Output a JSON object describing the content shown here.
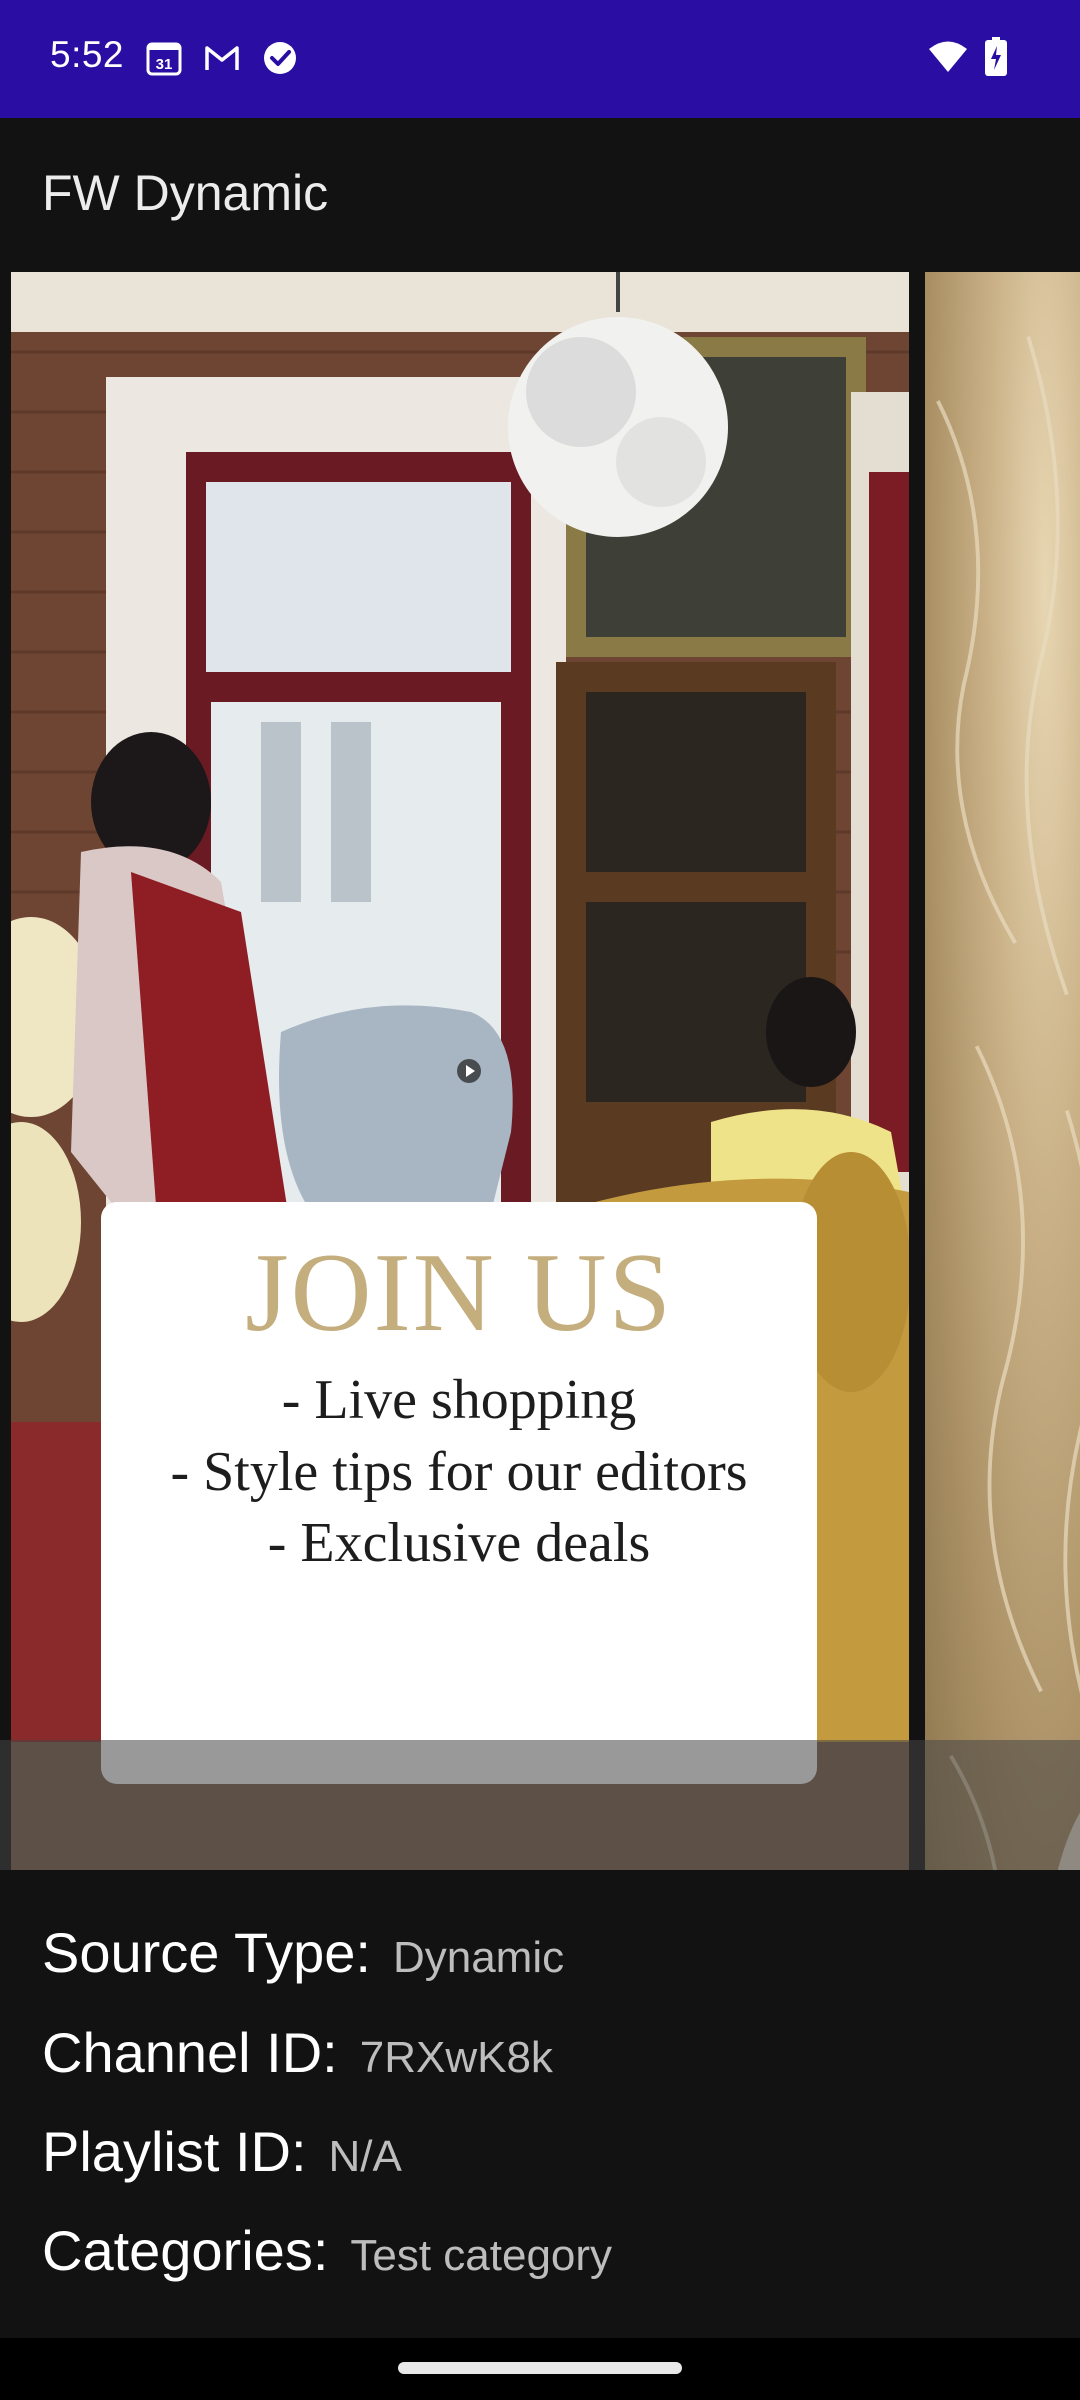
{
  "status_bar": {
    "time": "5:52",
    "icons": [
      "calendar-icon",
      "gmail-icon",
      "check-circle-icon",
      "wifi-icon",
      "battery-charging-icon"
    ],
    "background_color": "#2a0ea3"
  },
  "app_bar": {
    "title": "FW Dynamic"
  },
  "carousel": {
    "cards": [
      {
        "promo": {
          "title": "JOIN US",
          "lines": [
            "- Live shopping",
            "- Style tips for our editors",
            "- Exclusive deals"
          ]
        },
        "title_color": "#c4ae7e"
      }
    ]
  },
  "info": {
    "source_type": {
      "label": "Source Type:",
      "value": "Dynamic"
    },
    "channel_id": {
      "label": "Channel ID:",
      "value": "7RXwK8k"
    },
    "playlist_id": {
      "label": "Playlist ID:",
      "value": "N/A"
    },
    "categories": {
      "label": "Categories:",
      "value": "Test category"
    }
  }
}
